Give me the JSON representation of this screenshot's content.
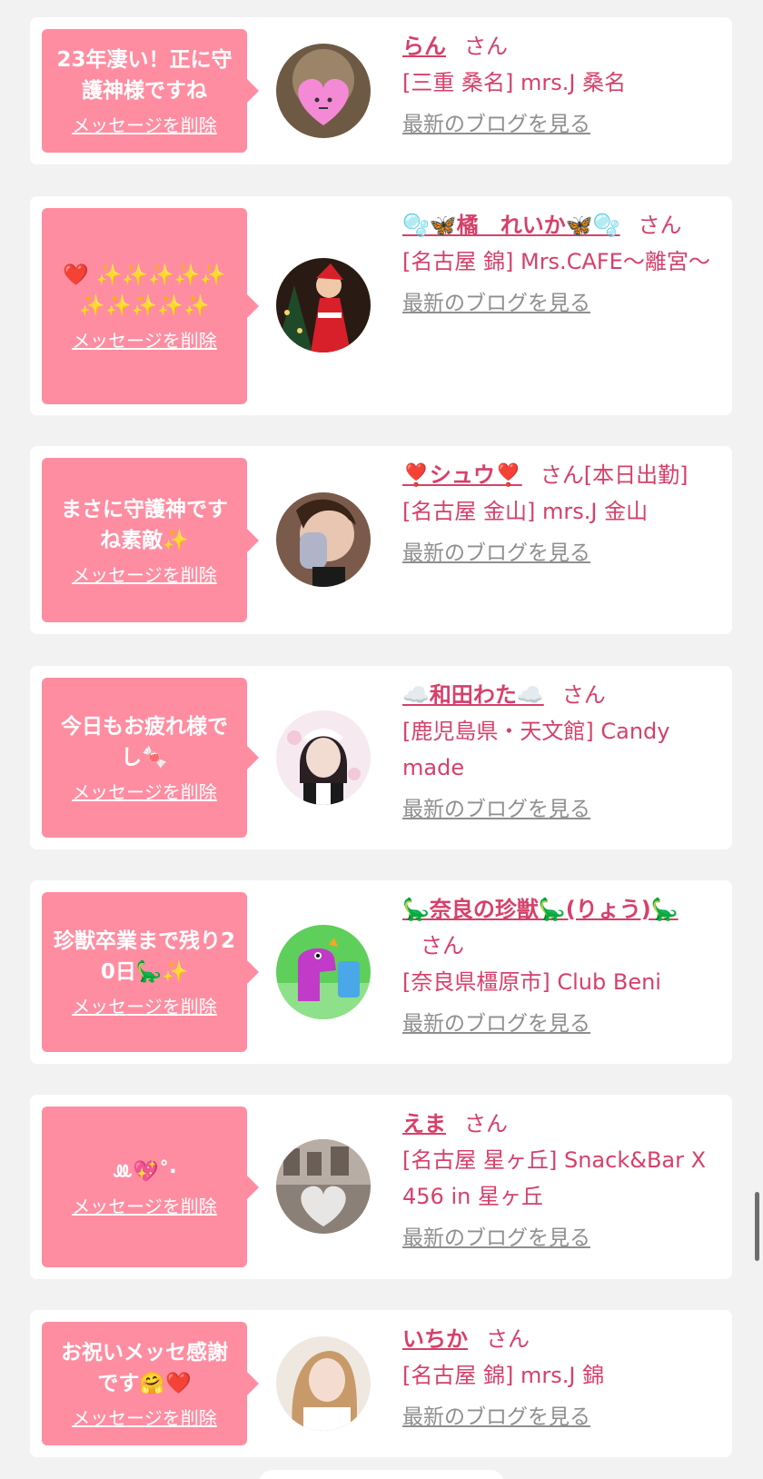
{
  "delete_label": "メッセージを削除",
  "blog_label": "最新のブログを見る",
  "san_label": "さん",
  "colors": {
    "background": "#f2f2f2",
    "card": "#ffffff",
    "bubble": "#ff8da1",
    "name_text": "#d6406a",
    "link_gray": "#8f8f8f"
  },
  "messages": [
    {
      "message": "23年凄い！正に守護神様ですね",
      "name": "らん",
      "name_suffix": "",
      "shop": "[三重 桑名] mrs.J 桑名",
      "avatar_icon": "heart-face-avatar"
    },
    {
      "message": "❤️ ✨✨✨✨✨✨✨✨✨✨",
      "name": "🫧🦋橘　れいか🦋🫧",
      "name_suffix": "",
      "shop": "[名古屋 錦] Mrs.CAFE〜離宮〜",
      "avatar_icon": "santa-dress-avatar"
    },
    {
      "message": "まさに守護神ですね素敵✨",
      "name": "❣️シュウ❣️",
      "name_suffix": "[本日出勤]",
      "shop": "[名古屋 金山] mrs.J 金山",
      "avatar_icon": "selfie-avatar"
    },
    {
      "message": "今日もお疲れ様でし🍬",
      "name": "☁️和田わた☁️",
      "name_suffix": "",
      "shop": "[鹿児島県・天文館] Candy made",
      "avatar_icon": "maid-avatar"
    },
    {
      "message": "珍獣卒業まで残り20日🦕✨",
      "name": "🦕奈良の珍獣🦕(りょう)🦕",
      "name_suffix": "",
      "shop": "[奈良県橿原市] Club Beni",
      "avatar_icon": "dinosaur-avatar"
    },
    {
      "message": "ꔛ💖˚‧",
      "name": "えま",
      "name_suffix": "",
      "shop": "[名古屋 星ヶ丘] Snack&Bar X 456 in 星ヶ丘",
      "avatar_icon": "ng-heart-avatar"
    },
    {
      "message": "お祝いメッセ感謝です🤗❤️",
      "name": "いちか",
      "name_suffix": "",
      "shop": "[名古屋 錦] mrs.J 錦",
      "avatar_icon": "portrait-avatar"
    }
  ]
}
